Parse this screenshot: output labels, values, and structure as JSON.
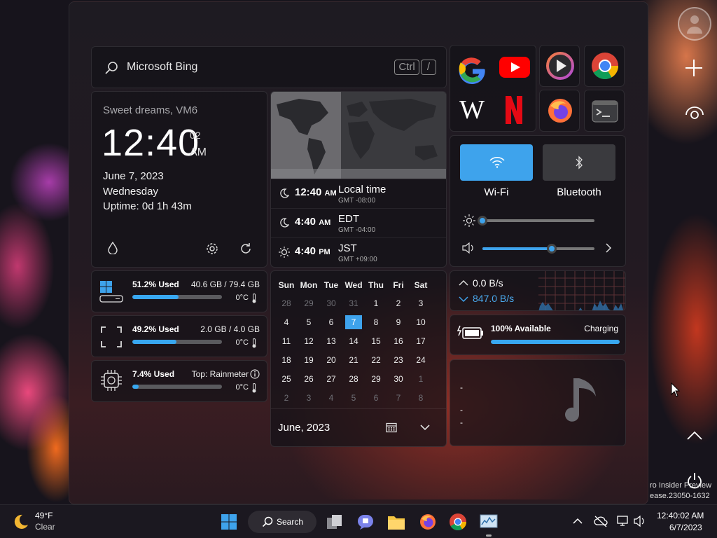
{
  "search": {
    "placeholder": "Microsoft Bing",
    "key1": "Ctrl",
    "key2": "/"
  },
  "clock": {
    "greeting": "Sweet dreams, VM6",
    "time": "12:40",
    "seconds": "02",
    "ampm": "AM",
    "date": "June 7, 2023",
    "weekday": "Wednesday",
    "uptime": "Uptime: 0d 1h 43m"
  },
  "timezones": [
    {
      "time": "12:40",
      "ampm": "AM",
      "name": "Local time",
      "offset": "GMT -08:00"
    },
    {
      "time": "4:40",
      "ampm": "AM",
      "name": "EDT",
      "offset": "GMT -04:00"
    },
    {
      "time": "4:40",
      "ampm": "PM",
      "name": "JST",
      "offset": "GMT +09:00"
    }
  ],
  "storage": {
    "used": "51.2% Used",
    "detail": "40.6 GB / 79.4 GB",
    "temp": "0°C",
    "percent": 51.2
  },
  "memory": {
    "used": "49.2% Used",
    "detail": "2.0 GB / 4.0 GB",
    "temp": "0°C",
    "percent": 49.2
  },
  "cpu": {
    "used": "7.4% Used",
    "detail": "Top: Rainmeter",
    "temp": "0°C",
    "percent": 7.4
  },
  "calendar": {
    "days": [
      "Sun",
      "Mon",
      "Tue",
      "Wed",
      "Thu",
      "Fri",
      "Sat"
    ],
    "weeks": [
      [
        "28",
        "29",
        "30",
        "31",
        "1",
        "2",
        "3"
      ],
      [
        "4",
        "5",
        "6",
        "7",
        "8",
        "9",
        "10"
      ],
      [
        "11",
        "12",
        "13",
        "14",
        "15",
        "16",
        "17"
      ],
      [
        "18",
        "19",
        "20",
        "21",
        "22",
        "23",
        "24"
      ],
      [
        "25",
        "26",
        "27",
        "28",
        "29",
        "30",
        "1"
      ],
      [
        "2",
        "3",
        "4",
        "5",
        "6",
        "7",
        "8"
      ]
    ],
    "month": "June, 2023"
  },
  "quick": {
    "wifi": "Wi-Fi",
    "bluetooth": "Bluetooth",
    "brightness": 0,
    "volume": 62
  },
  "network": {
    "up": "0.0 B/s",
    "down": "847.0 B/s"
  },
  "battery": {
    "status": "100% Available",
    "state": "Charging",
    "percent": 100
  },
  "music": {
    "line1": "-",
    "line2": "-",
    "line3": "-"
  },
  "taskbar": {
    "temp": "49°F",
    "condition": "Clear",
    "search": "Search",
    "time": "12:40:02 AM",
    "date": "6/7/2023"
  },
  "watermark": {
    "line1": "ro Insider Preview",
    "line2": "ease.23050-1632"
  }
}
